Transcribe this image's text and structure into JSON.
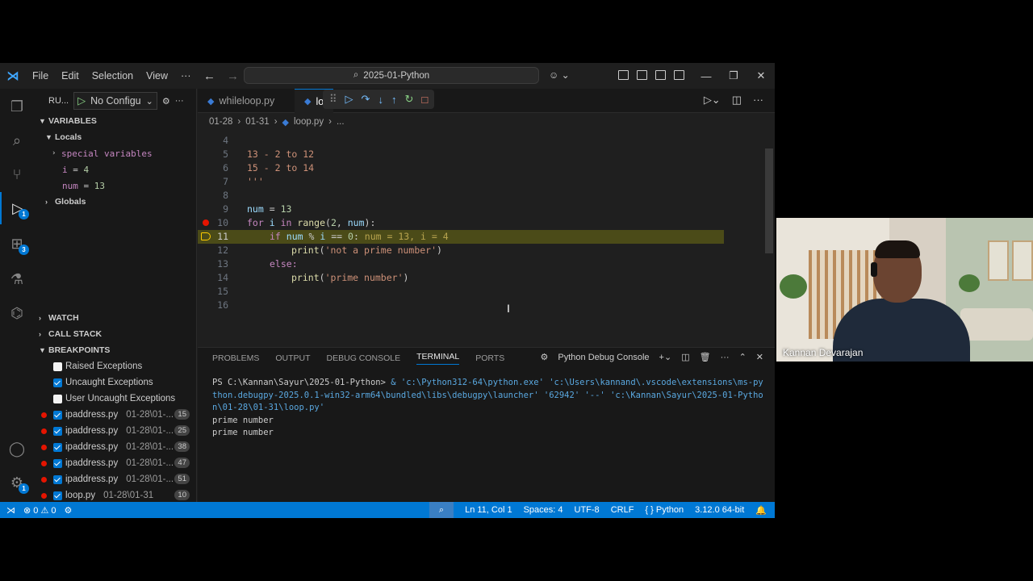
{
  "menu": [
    "File",
    "Edit",
    "Selection",
    "View",
    "···"
  ],
  "search": {
    "text": "2025-01-Python"
  },
  "sidebar": {
    "run_label": "RU...",
    "config_name": "No Configu",
    "variables_header": "VARIABLES",
    "locals_label": "Locals",
    "special_vars": "special variables",
    "vars": [
      {
        "name": "i",
        "value": "4"
      },
      {
        "name": "num",
        "value": "13"
      }
    ],
    "globals_label": "Globals",
    "watch_header": "WATCH",
    "callstack_header": "CALL STACK",
    "breakpoints_header": "BREAKPOINTS",
    "exceptions": [
      {
        "label": "Raised Exceptions",
        "checked": false
      },
      {
        "label": "Uncaught Exceptions",
        "checked": true
      },
      {
        "label": "User Uncaught Exceptions",
        "checked": false
      }
    ],
    "breakpoints": [
      {
        "file": "ipaddress.py",
        "path": "01-28\\01-...",
        "line": "15"
      },
      {
        "file": "ipaddress.py",
        "path": "01-28\\01-...",
        "line": "25"
      },
      {
        "file": "ipaddress.py",
        "path": "01-28\\01-...",
        "line": "38"
      },
      {
        "file": "ipaddress.py",
        "path": "01-28\\01-...",
        "line": "47"
      },
      {
        "file": "ipaddress.py",
        "path": "01-28\\01-...",
        "line": "51"
      },
      {
        "file": "loop.py",
        "path": "01-28\\01-31",
        "line": "10"
      }
    ]
  },
  "activity_badges": {
    "debug": "1",
    "extensions": "3",
    "settings": "1"
  },
  "tabs": [
    {
      "label": "whileloop.py"
    },
    {
      "label": "lo"
    }
  ],
  "breadcrumb": [
    "01-28",
    "01-31",
    "loop.py",
    "..."
  ],
  "editor": {
    "line_numbers": [
      "4",
      "5",
      "6",
      "7",
      "8",
      "9",
      "10",
      "11",
      "12",
      "13",
      "14",
      "15",
      "16"
    ],
    "line5": "13 - 2 to 12",
    "line6": "15 - 2 to 14",
    "line7": "'''",
    "line9_var": "num",
    "line9_val": "13",
    "line11_inline": "num = 13, i = 4",
    "line12_str": "'not a prime number'",
    "line14_str": "'prime number'"
  },
  "panel": {
    "tabs": [
      "PROBLEMS",
      "OUTPUT",
      "DEBUG CONSOLE",
      "TERMINAL",
      "PORTS"
    ],
    "active_tab": "TERMINAL",
    "console_label": "Python Debug Console",
    "prompt": "PS C:\\Kannan\\Sayur\\2025-01-Python> ",
    "command": " & 'c:\\Python312-64\\python.exe' 'c:\\Users\\kannand\\.vscode\\extensions\\ms-python.debugpy-2025.0.1-win32-arm64\\bundled\\libs\\debugpy\\launcher' '62942' '--' 'c:\\Kannan\\Sayur\\2025-01-Python\\01-28\\01-31\\loop.py'",
    "output": [
      "prime number",
      "prime number"
    ]
  },
  "statusbar": {
    "errors": "0",
    "warnings": "0",
    "position": "Ln 11, Col 1",
    "spaces": "Spaces: 4",
    "encoding": "UTF-8",
    "eol": "CRLF",
    "language": "Python",
    "interpreter": "3.12.0 64-bit"
  },
  "webcam": {
    "name": "Kannan Devarajan"
  },
  "colors": {
    "accent": "#0078d4",
    "breakpoint": "#e51400",
    "current_line": "#4b4b18"
  }
}
